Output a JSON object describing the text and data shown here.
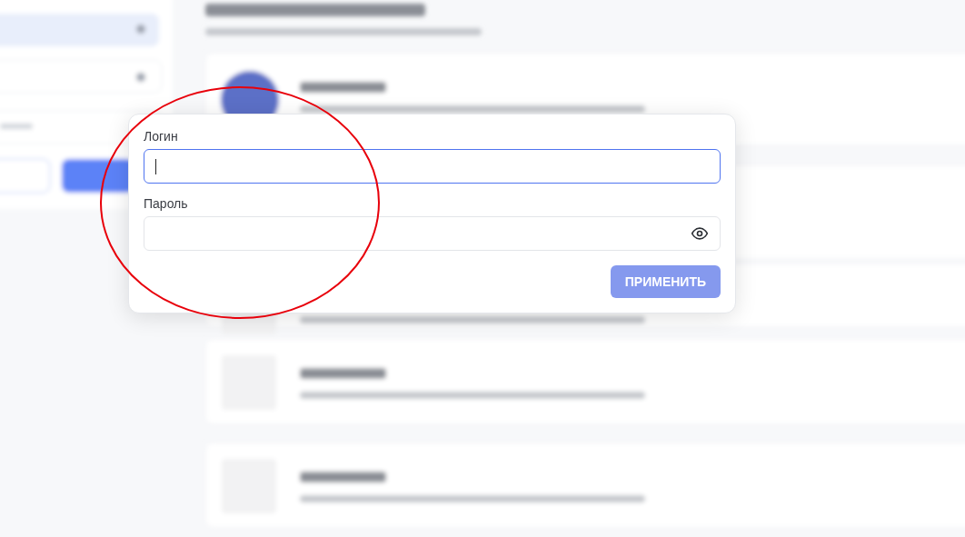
{
  "form": {
    "fields": [
      {
        "label": "Логин",
        "kind": "text",
        "focused": true
      },
      {
        "label": "Пароль",
        "kind": "password",
        "focused": false
      }
    ],
    "button": {
      "label": "ПРИМЕНИТЬ",
      "disabled": true
    }
  }
}
